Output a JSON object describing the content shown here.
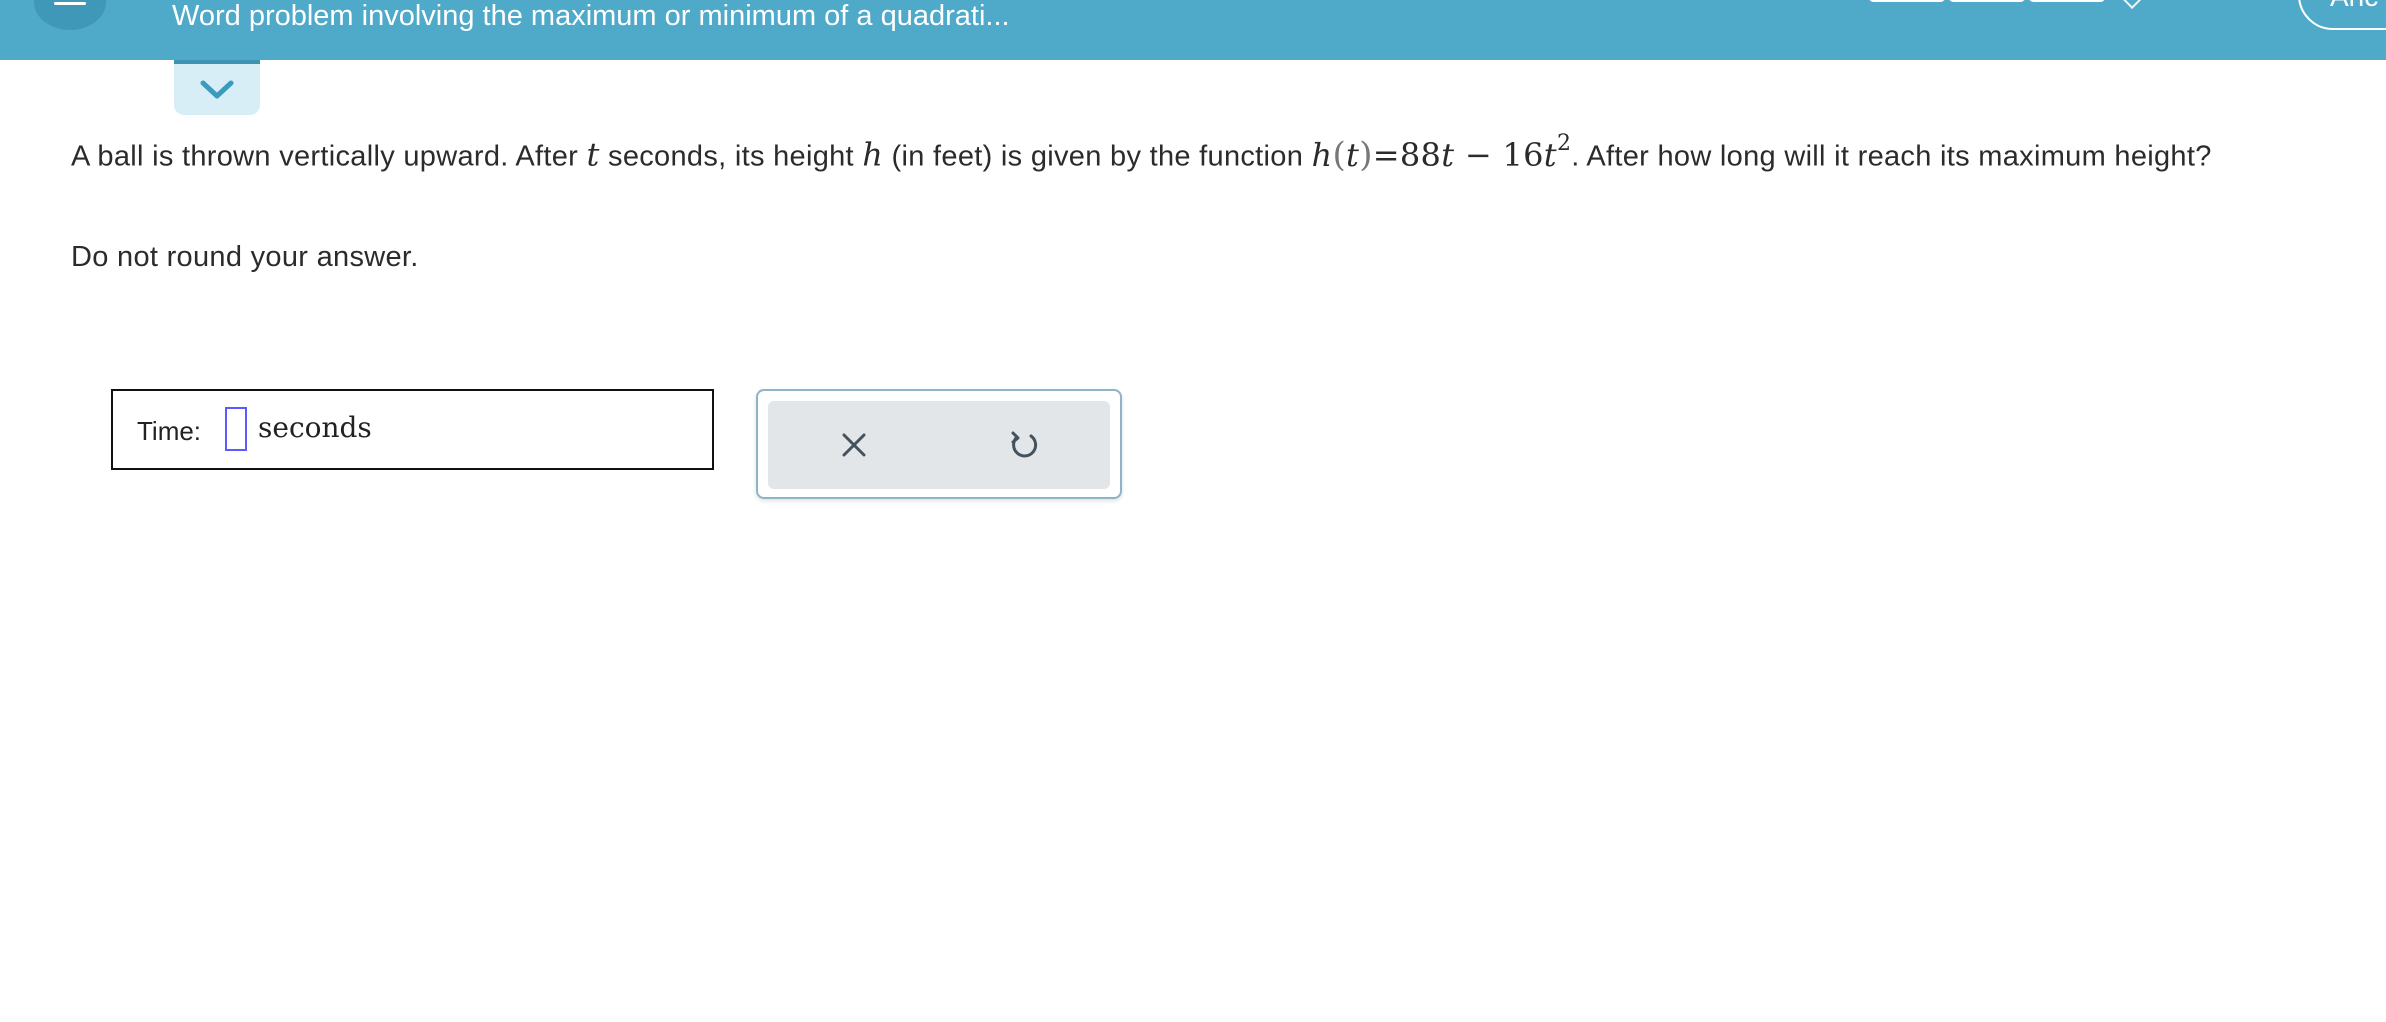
{
  "header": {
    "title": "Word problem involving the maximum or minimum of a quadrati...",
    "right_button_label": "Anc"
  },
  "question": {
    "part1": "A ball is thrown vertically upward. After ",
    "var_t": "t",
    "part2": " seconds, its height ",
    "var_h": "h",
    "part3": " (in feet) is given by the function ",
    "func_h": "h",
    "func_paren_open": "(",
    "func_t": "t",
    "func_paren_close": ")",
    "func_eq": "=",
    "func_coef1": "88",
    "func_t2": "t",
    "func_minus": " − ",
    "func_coef2": "16",
    "func_t3": "t",
    "func_exp": "2",
    "part4": ". After how long will it reach its maximum height?",
    "instruction": "Do not round your answer."
  },
  "answer": {
    "label": "Time:",
    "value": "",
    "unit": "seconds"
  },
  "icons": {
    "menu": "menu-icon",
    "chevron": "chevron-down-icon",
    "clear": "close-icon",
    "undo": "undo-icon"
  },
  "colors": {
    "header": "#4fa9c8",
    "input_border": "#5a5aff",
    "action_bg": "#e2e6e9"
  }
}
